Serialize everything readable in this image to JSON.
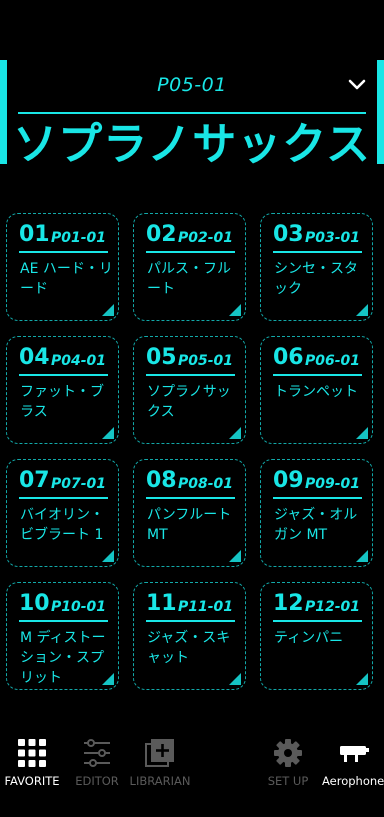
{
  "header": {
    "patch_code": "P05-01",
    "patch_name": "ソプラノサックス"
  },
  "cards": [
    {
      "num": "01",
      "code": "P01-01",
      "name": "AE ハード・リード"
    },
    {
      "num": "02",
      "code": "P02-01",
      "name": "パルス・フルート"
    },
    {
      "num": "03",
      "code": "P03-01",
      "name": "シンセ・スタック"
    },
    {
      "num": "04",
      "code": "P04-01",
      "name": "ファット・ブラス"
    },
    {
      "num": "05",
      "code": "P05-01",
      "name": "ソプラノサックス"
    },
    {
      "num": "06",
      "code": "P06-01",
      "name": "トランペット"
    },
    {
      "num": "07",
      "code": "P07-01",
      "name": "バイオリン・ビブラート 1"
    },
    {
      "num": "08",
      "code": "P08-01",
      "name": "パンフルート MT"
    },
    {
      "num": "09",
      "code": "P09-01",
      "name": "ジャズ・オルガン MT"
    },
    {
      "num": "10",
      "code": "P10-01",
      "name": "M ディストーション・スプリット"
    },
    {
      "num": "11",
      "code": "P11-01",
      "name": "ジャズ・スキャット"
    },
    {
      "num": "12",
      "code": "P12-01",
      "name": "ティンパニ"
    }
  ],
  "nav": {
    "favorite": "FAVORITE",
    "editor": "EDITOR",
    "librarian": "LIBRARIAN",
    "setup": "SET UP",
    "aerophone": "Aerophone"
  },
  "colors": {
    "accent": "#19e6e6",
    "card_border": "#12a8a8",
    "nav_active": "#ffffff",
    "nav_inactive": "#5a5a5a"
  }
}
